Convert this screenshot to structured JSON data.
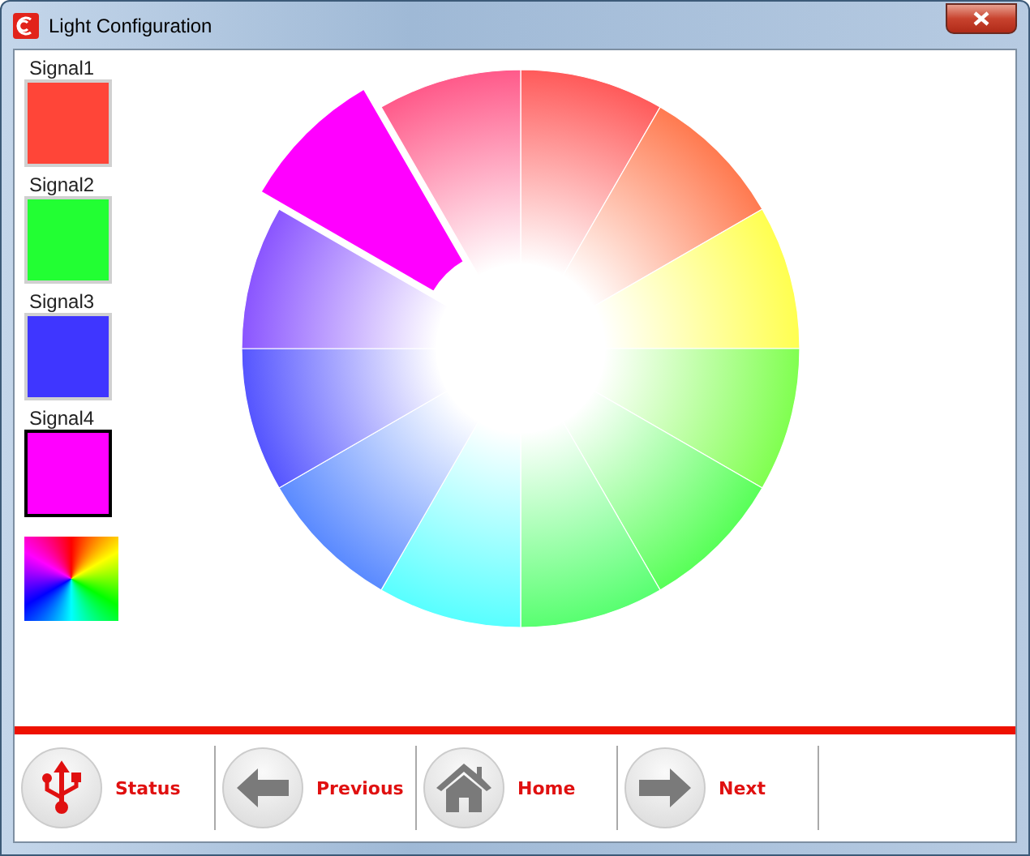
{
  "window": {
    "title": "Light Configuration"
  },
  "signals": [
    {
      "name": "Signal1",
      "color": "#ff4538",
      "selected": false
    },
    {
      "name": "Signal2",
      "color": "#22ff33",
      "selected": false
    },
    {
      "name": "Signal3",
      "color": "#3f36ff",
      "selected": false
    },
    {
      "name": "Signal4",
      "color": "#ff00ff",
      "selected": true
    }
  ],
  "wheel": {
    "segments": [
      {
        "color": "#ff5a5a",
        "selected": false
      },
      {
        "color": "#ff7a50",
        "selected": false
      },
      {
        "color": "#ffff50",
        "selected": false
      },
      {
        "color": "#80ff50",
        "selected": false
      },
      {
        "color": "#58ff58",
        "selected": false
      },
      {
        "color": "#58ff70",
        "selected": false
      },
      {
        "color": "#58ffff",
        "selected": false
      },
      {
        "color": "#5a8aff",
        "selected": false
      },
      {
        "color": "#5555ff",
        "selected": false
      },
      {
        "color": "#8a55ff",
        "selected": false
      },
      {
        "color": "#ff00ff",
        "selected": true
      },
      {
        "color": "#ff5a8a",
        "selected": false
      }
    ]
  },
  "nav": [
    {
      "kind": "usb",
      "label": "Status"
    },
    {
      "kind": "back",
      "label": "Previous"
    },
    {
      "kind": "home",
      "label": "Home"
    },
    {
      "kind": "forward",
      "label": "Next"
    }
  ]
}
